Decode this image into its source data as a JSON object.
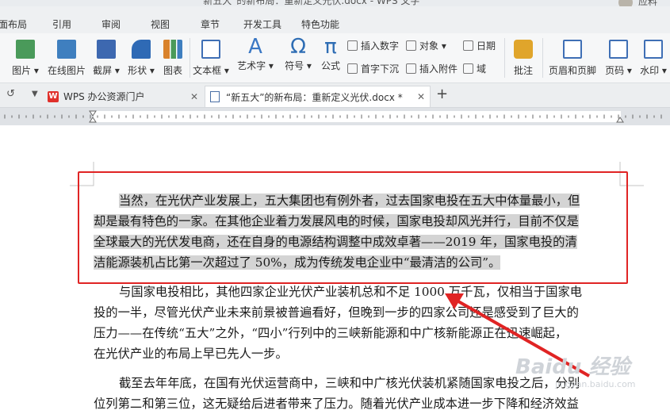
{
  "window": {
    "title": "“新五大”的新布局：重新定义光伏.docx - WPS 文字",
    "user_name": "应料"
  },
  "menu": [
    "面布局",
    "引用",
    "审阅",
    "视图",
    "章节",
    "开发工具",
    "特色功能"
  ],
  "ribbon": {
    "big_buttons": [
      {
        "label": "图片 ▾",
        "icon": "picture-icon",
        "color": "#4a9a5a"
      },
      {
        "label": "在线图片",
        "icon": "online-picture-icon",
        "color": "#3f7fbf"
      },
      {
        "label": "截屏 ▾",
        "icon": "screenshot-icon",
        "color": "#3d68b0"
      },
      {
        "label": "形状 ▾",
        "icon": "shapes-icon",
        "color": "#2f6ab5"
      },
      {
        "label": "图表",
        "icon": "chart-icon",
        "color": "#d9822b"
      },
      {
        "label": "文本框 ▾",
        "icon": "textbox-icon",
        "color": "#3f6fb5"
      },
      {
        "label": "艺术字 ▾",
        "icon": "wordart-icon",
        "color": "#3b78c4"
      },
      {
        "label": "符号 ▾",
        "icon": "omega-icon",
        "color": "#2e6db4"
      },
      {
        "label": "公式",
        "icon": "pi-icon",
        "color": "#2e6db4"
      },
      {
        "label": "批注",
        "icon": "comment-icon",
        "color": "#e0a52b"
      },
      {
        "label": "页眉和页脚",
        "icon": "header-footer-icon",
        "color": "#3f6fb5"
      },
      {
        "label": "页码 ▾",
        "icon": "page-number-icon",
        "color": "#3f6fb5"
      },
      {
        "label": "水印 ▾",
        "icon": "watermark-icon",
        "color": "#3f6fb5"
      }
    ],
    "small_buttons": [
      {
        "label": "插入数字",
        "icon": "insert-number-icon"
      },
      {
        "label": "对象 ▾",
        "icon": "object-icon"
      },
      {
        "label": "日期",
        "icon": "date-icon"
      },
      {
        "label": "首字下沉",
        "icon": "drop-cap-icon"
      },
      {
        "label": "插入附件",
        "icon": "attachment-icon"
      },
      {
        "label": "域",
        "icon": "field-icon"
      }
    ],
    "glyphs": {
      "omega": "Ω",
      "pi": "π",
      "wordart": "A"
    }
  },
  "tabs": [
    {
      "label": "WPS 办公资源门户",
      "logo": "W"
    },
    {
      "label": "“新五大”的新布局：重新定义光伏.docx *"
    }
  ],
  "document": {
    "highlighted_lines": [
      "当然，在光伏产业发展上，五大集团也有例外者，过去国家电投在五大中体量最小，但",
      "却是最有特色的一家。在其他企业着力发展风电的时候，国家电投却风光并行，目前不仅是",
      "全球最大的光伏发电商，还在自身的电源结构调整中成效卓著——2019 年，国家电投的清",
      "洁能源装机占比第一次超过了 50%，成为传统发电企业中“最清洁的公司”。"
    ],
    "para2_lines": [
      "与国家电投相比，其他四家企业光伏产业装机总和不足 1000 万千瓦，仅相当于国家电",
      "投的一半，尽管光伏产业未来前景被普遍看好，但晚到一步的四家公司还是感受到了巨大的",
      "压力——在传统“五大”之外，“四小”行列中的三峡新能源和中广核新能源正在迅速崛起，",
      "在光伏产业的布局上早已先人一步。"
    ],
    "para3_lines": [
      "截至去年年底，在国有光伏运营商中，三峡和中广核光伏装机紧随国家电投之后，分别",
      "位列第二和第三位，这无疑给后进者带来了压力。随着光伏产业成本进一步下降和经济效益"
    ]
  },
  "watermark": {
    "text": "Baidu 经验",
    "sub": "jingyan.baidu.com"
  },
  "colors": {
    "annotation_red": "#e02424",
    "selection_gray": "#d4d4d4"
  }
}
